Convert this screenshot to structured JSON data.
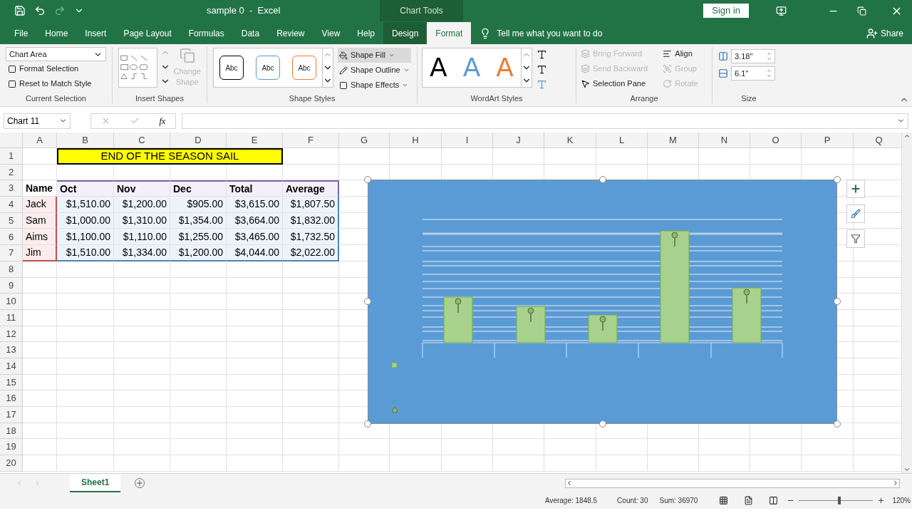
{
  "window": {
    "title": "sample 0  -  Excel",
    "context_title": "Chart Tools",
    "sign_in": "Sign in"
  },
  "tabs": [
    {
      "label": "File",
      "selected": false
    },
    {
      "label": "Home",
      "selected": false
    },
    {
      "label": "Insert",
      "selected": false
    },
    {
      "label": "Page Layout",
      "selected": false
    },
    {
      "label": "Formulas",
      "selected": false
    },
    {
      "label": "Data",
      "selected": false
    },
    {
      "label": "Review",
      "selected": false
    },
    {
      "label": "View",
      "selected": false
    },
    {
      "label": "Help",
      "selected": false
    },
    {
      "label": "Design",
      "selected": false,
      "kind": "context"
    },
    {
      "label": "Format",
      "selected": true,
      "kind": "context"
    }
  ],
  "tell_me": "Tell me what you want to do",
  "share": "Share",
  "ribbon": {
    "current_selection": {
      "element": "Chart Area",
      "commands": [
        "Format Selection",
        "Reset to Match Style"
      ],
      "label": "Current Selection"
    },
    "insert_shapes": {
      "change_shape": {
        "label": "Change Shape",
        "disabled": true
      },
      "label": "Insert Shapes"
    },
    "shape_styles": {
      "presets": [
        {
          "label": "Abc",
          "color": "#000000"
        },
        {
          "label": "Abc",
          "color": "#5b9bd5"
        },
        {
          "label": "Abc",
          "color": "#ed7d31"
        }
      ],
      "commands": [
        "Shape Fill",
        "Shape Outline",
        "Shape Effects"
      ],
      "label": "Shape Styles"
    },
    "wordart_styles": {
      "presets": [
        {
          "label": "A",
          "color": "#000000"
        },
        {
          "label": "A",
          "color": "#5b9bd5"
        },
        {
          "label": "A",
          "color": "#ed7d31"
        }
      ],
      "label": "WordArt Styles"
    },
    "arrange": {
      "items": [
        {
          "label": "Bring Forward",
          "disabled": true
        },
        {
          "label": "Send Backward",
          "disabled": true
        },
        {
          "label": "Selection Pane",
          "disabled": false
        },
        {
          "label": "Align",
          "disabled": false
        },
        {
          "label": "Group",
          "disabled": true
        },
        {
          "label": "Rotate",
          "disabled": true
        }
      ],
      "label": "Arrange"
    },
    "size": {
      "fields": [
        {
          "kind": "height",
          "value": "3.18\""
        },
        {
          "kind": "width",
          "value": "6.1\""
        }
      ],
      "label": "Size"
    }
  },
  "formula_bar": {
    "name_box": "Chart 11",
    "function_label": "fx"
  },
  "sheet": {
    "columns": [
      "A",
      "B",
      "C",
      "D",
      "E",
      "F",
      "G",
      "H",
      "I",
      "J",
      "K",
      "L",
      "M",
      "N",
      "O",
      "P",
      "Q"
    ],
    "rows": [
      "1",
      "2",
      "3",
      "4",
      "5",
      "6",
      "7",
      "8",
      "9",
      "10",
      "11",
      "12",
      "13",
      "14",
      "15",
      "16",
      "17",
      "18",
      "19",
      "20"
    ],
    "title": "END OF THE SEASON SAIL",
    "header": [
      "Name",
      "Oct",
      "Nov",
      "Dec",
      "Total",
      "Average"
    ],
    "data": [
      [
        "Jack",
        "$1,510.00",
        "$1,200.00",
        "$905.00",
        "$3,615.00",
        "$1,807.50"
      ],
      [
        "Sam",
        "$1,000.00",
        "$1,310.00",
        "$1,354.00",
        "$3,664.00",
        "$1,832.00"
      ],
      [
        "Aims",
        "$1,100.00",
        "$1,110.00",
        "$1,255.00",
        "$3,465.00",
        "$1,732.50"
      ],
      [
        "Jim",
        "$1,510.00",
        "$1,334.00",
        "$1,200.00",
        "$4,044.00",
        "$2,022.00"
      ]
    ]
  },
  "sheet_tabs": [
    {
      "label": "Sheet1",
      "selected": true
    }
  ],
  "status_bar": {
    "stats": [
      "Average: 1848.5",
      "Count: 30",
      "Sum: 36970"
    ],
    "zoom": {
      "level": 0.54,
      "label": "120%"
    }
  }
}
